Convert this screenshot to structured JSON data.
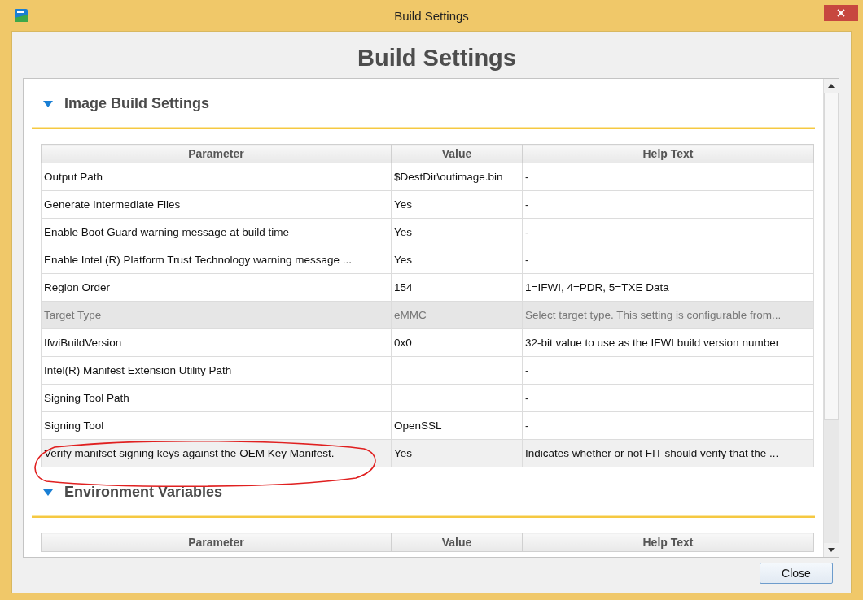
{
  "window": {
    "title": "Build Settings"
  },
  "heading": "Build Settings",
  "sections": [
    {
      "title": "Image Build Settings",
      "expanded": true,
      "columns": [
        "Parameter",
        "Value",
        "Help Text"
      ],
      "rows": [
        {
          "parameter": "Output Path",
          "value": "$DestDir\\outimage.bin",
          "help": "-",
          "disabled": false,
          "selected": false
        },
        {
          "parameter": "Generate Intermediate Files",
          "value": "Yes",
          "help": "-",
          "disabled": false,
          "selected": false
        },
        {
          "parameter": "Enable Boot Guard warning message at build time",
          "value": "Yes",
          "help": "-",
          "disabled": false,
          "selected": false
        },
        {
          "parameter": "Enable Intel (R) Platform Trust Technology warning message ...",
          "value": "Yes",
          "help": "-",
          "disabled": false,
          "selected": false
        },
        {
          "parameter": "Region Order",
          "value": "154",
          "help": "1=IFWI, 4=PDR, 5=TXE Data",
          "disabled": false,
          "selected": false
        },
        {
          "parameter": "Target Type",
          "value": "eMMC",
          "help": "Select target type. This setting is configurable from...",
          "disabled": true,
          "selected": false
        },
        {
          "parameter": "IfwiBuildVersion",
          "value": "0x0",
          "help": "32-bit value to use as the IFWI build version number",
          "disabled": false,
          "selected": false
        },
        {
          "parameter": "Intel(R) Manifest Extension Utility Path",
          "value": "",
          "help": "-",
          "disabled": false,
          "selected": false
        },
        {
          "parameter": "Signing Tool Path",
          "value": "",
          "help": "-",
          "disabled": false,
          "selected": false
        },
        {
          "parameter": "Signing Tool",
          "value": "OpenSSL",
          "help": "-",
          "disabled": false,
          "selected": false
        },
        {
          "parameter": "Verify manifset signing keys against the OEM Key Manifest.",
          "value": "Yes",
          "help": "Indicates whether or not FIT should verify that the ...",
          "disabled": false,
          "selected": true
        }
      ]
    },
    {
      "title": "Environment Variables",
      "expanded": true,
      "columns": [
        "Parameter",
        "Value",
        "Help Text"
      ]
    }
  ],
  "buttons": [
    "Close"
  ]
}
